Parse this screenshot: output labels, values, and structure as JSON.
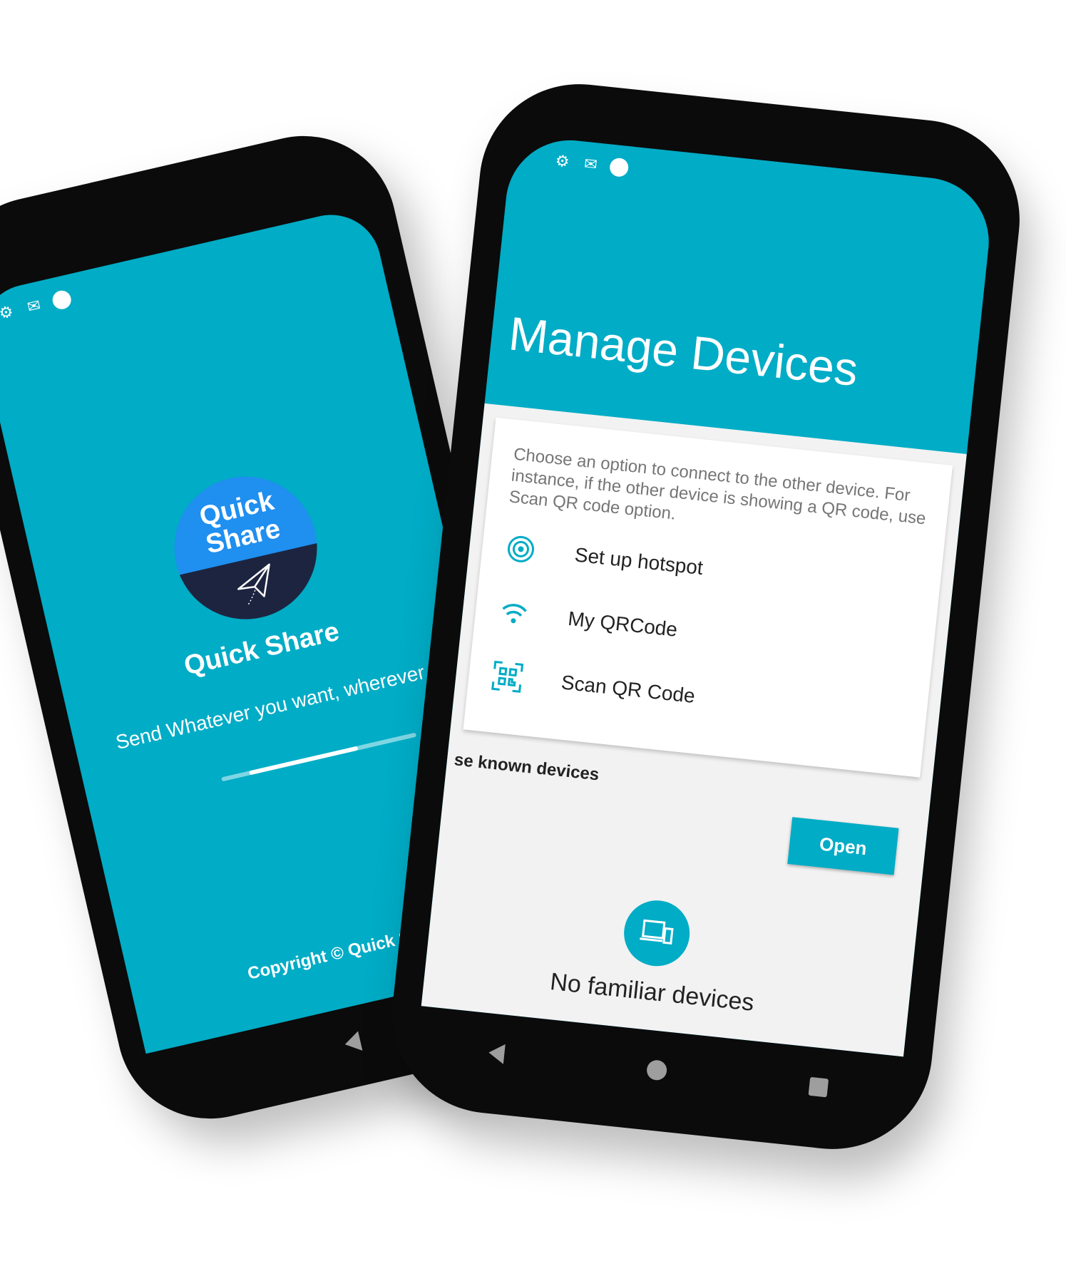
{
  "left_phone": {
    "logo_text": "Quick Share",
    "app_name": "Quick Share",
    "tagline": "Send Whatever you want, wherever y",
    "copyright": "Copyright © Quick Shar",
    "progress_fraction": 0.65
  },
  "right_phone": {
    "title": "Manage Devices",
    "description": "Choose an option to connect to the other device. For instance, if the other device is showing a QR code, use Scan QR code option.",
    "options": [
      {
        "label": "Set up hotspot",
        "icon": "hotspot-icon"
      },
      {
        "label": "My QRCode",
        "icon": "wifi-icon"
      },
      {
        "label": "Scan QR Code",
        "icon": "qr-scan-icon"
      }
    ],
    "known_devices_label": "se known devices",
    "open_button": "Open",
    "empty_state": "No familiar devices"
  },
  "colors": {
    "primary": "#00acc6",
    "logo_blue": "#1f8ff0",
    "logo_dark": "#1d2440"
  }
}
